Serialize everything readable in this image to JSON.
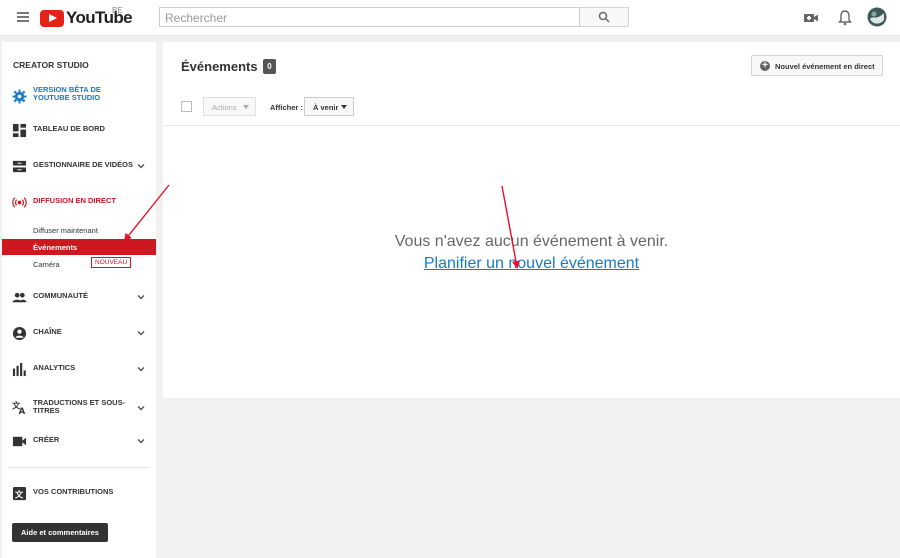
{
  "header": {
    "logo_text": "YouTube",
    "region": "BE",
    "search_placeholder": "Rechercher"
  },
  "sidebar": {
    "title": "CREATOR STUDIO",
    "beta_line1": "VERSION BÊTA DE",
    "beta_line2": "YOUTUBE STUDIO",
    "dashboard": "TABLEAU DE BORD",
    "video_manager": "GESTIONNAIRE DE VIDÉOS",
    "live": "DIFFUSION EN DIRECT",
    "live_sub": {
      "stream_now": "Diffuser maintenant",
      "events": "Événements",
      "camera": "Caméra",
      "new_badge": "NOUVEAU"
    },
    "community": "COMMUNAUTÉ",
    "channel": "CHAÎNE",
    "analytics": "ANALYTICS",
    "translations_line1": "TRADUCTIONS ET SOUS-",
    "translations_line2": "TITRES",
    "create": "CRÉER",
    "contributions": "VOS CONTRIBUTIONS",
    "help_button": "Aide et commentaires"
  },
  "main": {
    "title": "Événements",
    "count": "0",
    "new_live_event": "Nouvel événement en direct",
    "actions": "Actions",
    "show_label": "Afficher :",
    "show_value": "À venir",
    "empty_message": "Vous n'avez aucun événement à venir.",
    "schedule_link": "Planifier un nouvel événement"
  },
  "colors": {
    "accent_red": "#cc181e",
    "link_blue": "#167ac6",
    "beta_blue": "#167ac6"
  }
}
